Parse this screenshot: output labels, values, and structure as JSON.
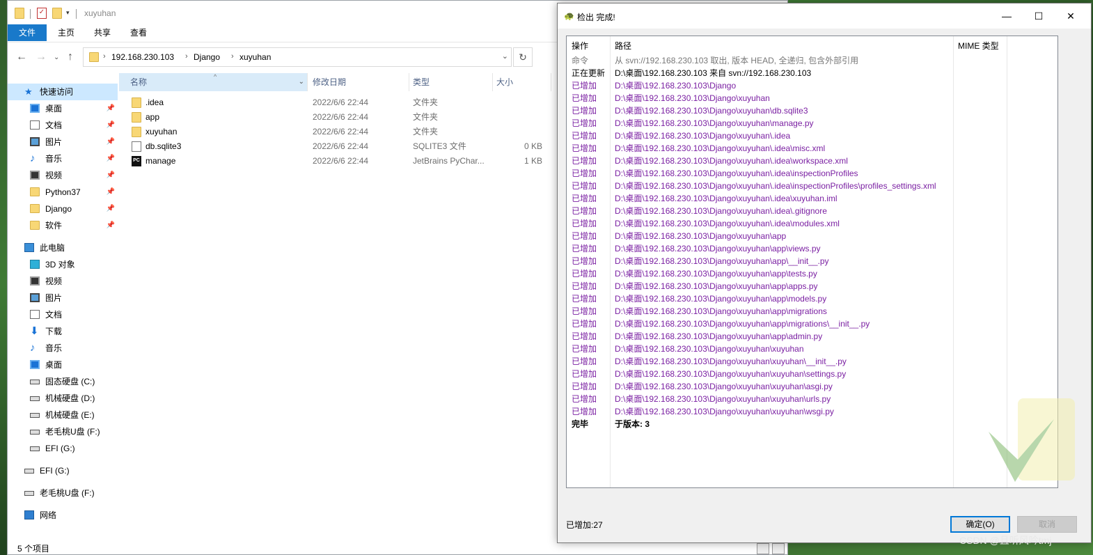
{
  "explorer": {
    "window_title": "xuyuhan",
    "ribbon_tabs": [
      "文件",
      "主页",
      "共享",
      "查看"
    ],
    "address": {
      "crumbs": [
        "192.168.230.103",
        "Django",
        "xuyuhan"
      ]
    },
    "sidebar": [
      {
        "label": "快速访问",
        "icon": "star-icon"
      },
      {
        "label": "桌面",
        "icon": "desktop-icon"
      },
      {
        "label": "文档",
        "icon": "document-icon"
      },
      {
        "label": "图片",
        "icon": "picture-icon"
      },
      {
        "label": "音乐",
        "icon": "music-icon"
      },
      {
        "label": "视频",
        "icon": "video-icon"
      },
      {
        "label": "Python37",
        "icon": "folder-icon"
      },
      {
        "label": "Django",
        "icon": "folder-icon"
      },
      {
        "label": "软件",
        "icon": "folder-icon"
      },
      {
        "label": "此电脑",
        "icon": "computer-icon"
      },
      {
        "label": "3D 对象",
        "icon": "3d-objects-icon"
      },
      {
        "label": "视频",
        "icon": "video-icon"
      },
      {
        "label": "图片",
        "icon": "picture-icon"
      },
      {
        "label": "文档",
        "icon": "document-icon"
      },
      {
        "label": "下载",
        "icon": "download-icon"
      },
      {
        "label": "音乐",
        "icon": "music-icon"
      },
      {
        "label": "桌面",
        "icon": "desktop-icon"
      },
      {
        "label": "固态硬盘 (C:)",
        "icon": "drive-icon"
      },
      {
        "label": "机械硬盘 (D:)",
        "icon": "drive-icon"
      },
      {
        "label": "机械硬盘 (E:)",
        "icon": "drive-icon"
      },
      {
        "label": "老毛桃U盘 (F:)",
        "icon": "drive-icon"
      },
      {
        "label": "EFI (G:)",
        "icon": "drive-icon"
      },
      {
        "label": "EFI (G:)",
        "icon": "drive-icon"
      },
      {
        "label": "老毛桃U盘 (F:)",
        "icon": "drive-icon"
      },
      {
        "label": "网络",
        "icon": "network-icon"
      }
    ],
    "columns": {
      "name": "名称",
      "date": "修改日期",
      "type": "类型",
      "size": "大小"
    },
    "files": [
      {
        "name": ".idea",
        "date": "2022/6/6 22:44",
        "type": "文件夹",
        "size": "",
        "icon": "folder-icon"
      },
      {
        "name": "app",
        "date": "2022/6/6 22:44",
        "type": "文件夹",
        "size": "",
        "icon": "folder-icon"
      },
      {
        "name": "xuyuhan",
        "date": "2022/6/6 22:44",
        "type": "文件夹",
        "size": "",
        "icon": "folder-icon"
      },
      {
        "name": "db.sqlite3",
        "date": "2022/6/6 22:44",
        "type": "SQLITE3 文件",
        "size": "0 KB",
        "icon": "file-icon"
      },
      {
        "name": "manage",
        "date": "2022/6/6 22:44",
        "type": "JetBrains PyChar...",
        "size": "1 KB",
        "icon": "pycharm-icon"
      }
    ],
    "status": "5 个项目"
  },
  "dialog": {
    "title": "检出 完成!",
    "columns": {
      "op": "操作",
      "path": "路径",
      "mime": "MIME 类型"
    },
    "rows": [
      {
        "op": "命令",
        "path": "从 svn://192.168.230.103 取出, 版本 HEAD, 全递归, 包含外部引用",
        "kind": "cmd"
      },
      {
        "op": "正在更新",
        "path": "D:\\桌面\\192.168.230.103 来自 svn://192.168.230.103",
        "kind": "upd"
      },
      {
        "op": "已增加",
        "path": "D:\\桌面\\192.168.230.103\\Django",
        "kind": "add"
      },
      {
        "op": "已增加",
        "path": "D:\\桌面\\192.168.230.103\\Django\\xuyuhan",
        "kind": "add"
      },
      {
        "op": "已增加",
        "path": "D:\\桌面\\192.168.230.103\\Django\\xuyuhan\\db.sqlite3",
        "kind": "add"
      },
      {
        "op": "已增加",
        "path": "D:\\桌面\\192.168.230.103\\Django\\xuyuhan\\manage.py",
        "kind": "add"
      },
      {
        "op": "已增加",
        "path": "D:\\桌面\\192.168.230.103\\Django\\xuyuhan\\.idea",
        "kind": "add"
      },
      {
        "op": "已增加",
        "path": "D:\\桌面\\192.168.230.103\\Django\\xuyuhan\\.idea\\misc.xml",
        "kind": "add"
      },
      {
        "op": "已增加",
        "path": "D:\\桌面\\192.168.230.103\\Django\\xuyuhan\\.idea\\workspace.xml",
        "kind": "add"
      },
      {
        "op": "已增加",
        "path": "D:\\桌面\\192.168.230.103\\Django\\xuyuhan\\.idea\\inspectionProfiles",
        "kind": "add"
      },
      {
        "op": "已增加",
        "path": "D:\\桌面\\192.168.230.103\\Django\\xuyuhan\\.idea\\inspectionProfiles\\profiles_settings.xml",
        "kind": "add"
      },
      {
        "op": "已增加",
        "path": "D:\\桌面\\192.168.230.103\\Django\\xuyuhan\\.idea\\xuyuhan.iml",
        "kind": "add"
      },
      {
        "op": "已增加",
        "path": "D:\\桌面\\192.168.230.103\\Django\\xuyuhan\\.idea\\.gitignore",
        "kind": "add"
      },
      {
        "op": "已增加",
        "path": "D:\\桌面\\192.168.230.103\\Django\\xuyuhan\\.idea\\modules.xml",
        "kind": "add"
      },
      {
        "op": "已增加",
        "path": "D:\\桌面\\192.168.230.103\\Django\\xuyuhan\\app",
        "kind": "add"
      },
      {
        "op": "已增加",
        "path": "D:\\桌面\\192.168.230.103\\Django\\xuyuhan\\app\\views.py",
        "kind": "add"
      },
      {
        "op": "已增加",
        "path": "D:\\桌面\\192.168.230.103\\Django\\xuyuhan\\app\\__init__.py",
        "kind": "add"
      },
      {
        "op": "已增加",
        "path": "D:\\桌面\\192.168.230.103\\Django\\xuyuhan\\app\\tests.py",
        "kind": "add"
      },
      {
        "op": "已增加",
        "path": "D:\\桌面\\192.168.230.103\\Django\\xuyuhan\\app\\apps.py",
        "kind": "add"
      },
      {
        "op": "已增加",
        "path": "D:\\桌面\\192.168.230.103\\Django\\xuyuhan\\app\\models.py",
        "kind": "add"
      },
      {
        "op": "已增加",
        "path": "D:\\桌面\\192.168.230.103\\Django\\xuyuhan\\app\\migrations",
        "kind": "add"
      },
      {
        "op": "已增加",
        "path": "D:\\桌面\\192.168.230.103\\Django\\xuyuhan\\app\\migrations\\__init__.py",
        "kind": "add"
      },
      {
        "op": "已增加",
        "path": "D:\\桌面\\192.168.230.103\\Django\\xuyuhan\\app\\admin.py",
        "kind": "add"
      },
      {
        "op": "已增加",
        "path": "D:\\桌面\\192.168.230.103\\Django\\xuyuhan\\xuyuhan",
        "kind": "add"
      },
      {
        "op": "已增加",
        "path": "D:\\桌面\\192.168.230.103\\Django\\xuyuhan\\xuyuhan\\__init__.py",
        "kind": "add"
      },
      {
        "op": "已增加",
        "path": "D:\\桌面\\192.168.230.103\\Django\\xuyuhan\\xuyuhan\\settings.py",
        "kind": "add"
      },
      {
        "op": "已增加",
        "path": "D:\\桌面\\192.168.230.103\\Django\\xuyuhan\\xuyuhan\\asgi.py",
        "kind": "add"
      },
      {
        "op": "已增加",
        "path": "D:\\桌面\\192.168.230.103\\Django\\xuyuhan\\xuyuhan\\urls.py",
        "kind": "add"
      },
      {
        "op": "已增加",
        "path": "D:\\桌面\\192.168.230.103\\Django\\xuyuhan\\xuyuhan\\wsgi.py",
        "kind": "add"
      },
      {
        "op": "完毕",
        "path": "于版本: 3",
        "kind": "done"
      }
    ],
    "status": "已增加:27",
    "ok_label": "确定(O)",
    "cancel_label": "取消"
  },
  "watermark": "CSDN @且听风吟tmj",
  "colors": {
    "accent": "#1979ca",
    "added_text": "#7a1fa2",
    "selected_bg": "#cce8ff"
  }
}
